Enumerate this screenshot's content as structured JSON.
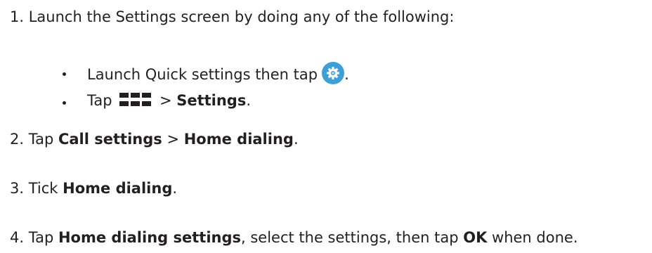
{
  "steps": [
    {
      "number": "1.",
      "text": "Launch the Settings screen by doing any of the following:"
    },
    {
      "number": "2.",
      "pre": "Tap ",
      "b1": "Call settings",
      "mid": " > ",
      "b2": "Home dialing",
      "post": "."
    },
    {
      "number": "3.",
      "pre": "Tick ",
      "b1": "Home dialing",
      "post": "."
    },
    {
      "number": "4.",
      "pre": "Tap ",
      "b1": "Home dialing settings",
      "mid": ", select the settings, then tap ",
      "b2": "OK",
      "post": " when done."
    }
  ],
  "bullets": [
    {
      "text": "Launch Quick settings then tap",
      "post": ".",
      "icon": "settings-gear-icon"
    },
    {
      "pre": "Tap",
      "mid": "> ",
      "bold": "Settings",
      "post": ".",
      "icon": "apps-grid-icon"
    }
  ],
  "colors": {
    "text": "#231f20",
    "icon_blue": "#3d9fd8"
  }
}
